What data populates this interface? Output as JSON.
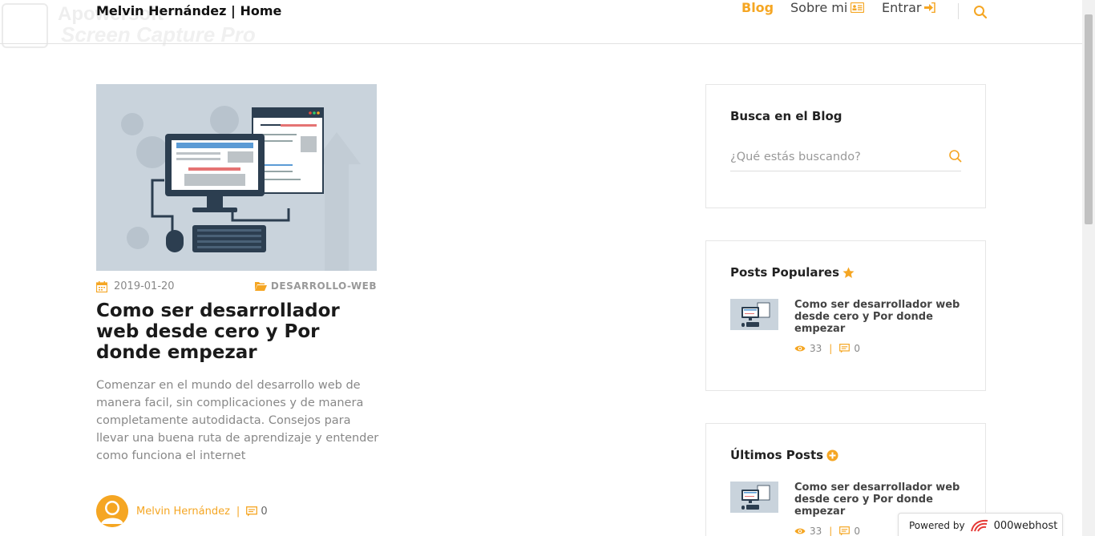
{
  "watermark": {
    "line1": "Apowersoft",
    "line2": "Screen Capture Pro"
  },
  "header": {
    "brand": "Melvin Hernández | Home",
    "nav": {
      "blog": "Blog",
      "sobre": "Sobre mi",
      "entrar": "Entrar"
    }
  },
  "post": {
    "date": "2019-01-20",
    "category": "DESARROLLO-WEB",
    "title": "Como ser desarrollador web desde cero y Por donde empezar",
    "excerpt": "Comenzar en el mundo del desarrollo web de manera facil, sin complicaciones y de manera completamente autodidacta. Consejos para llevar una buena ruta de aprendizaje y entender como funciona el internet",
    "author": "Melvin Hernández",
    "comments": "0"
  },
  "sidebar": {
    "search": {
      "title": "Busca en el Blog",
      "placeholder": "¿Qué estás buscando?"
    },
    "popular": {
      "title": "Posts Populares",
      "item": {
        "title": "Como ser desarrollador web desde cero y Por donde empezar",
        "views": "33",
        "comments": "0"
      }
    },
    "latest": {
      "title": "Últimos Posts",
      "item": {
        "title": "Como ser desarrollador web desde cero y Por donde empezar",
        "views": "33",
        "comments": "0"
      }
    }
  },
  "powered": {
    "label": "Powered by",
    "brand": "000webhost"
  },
  "colors": {
    "accent": "#f5a623",
    "text": "#222222",
    "muted": "#888888"
  }
}
